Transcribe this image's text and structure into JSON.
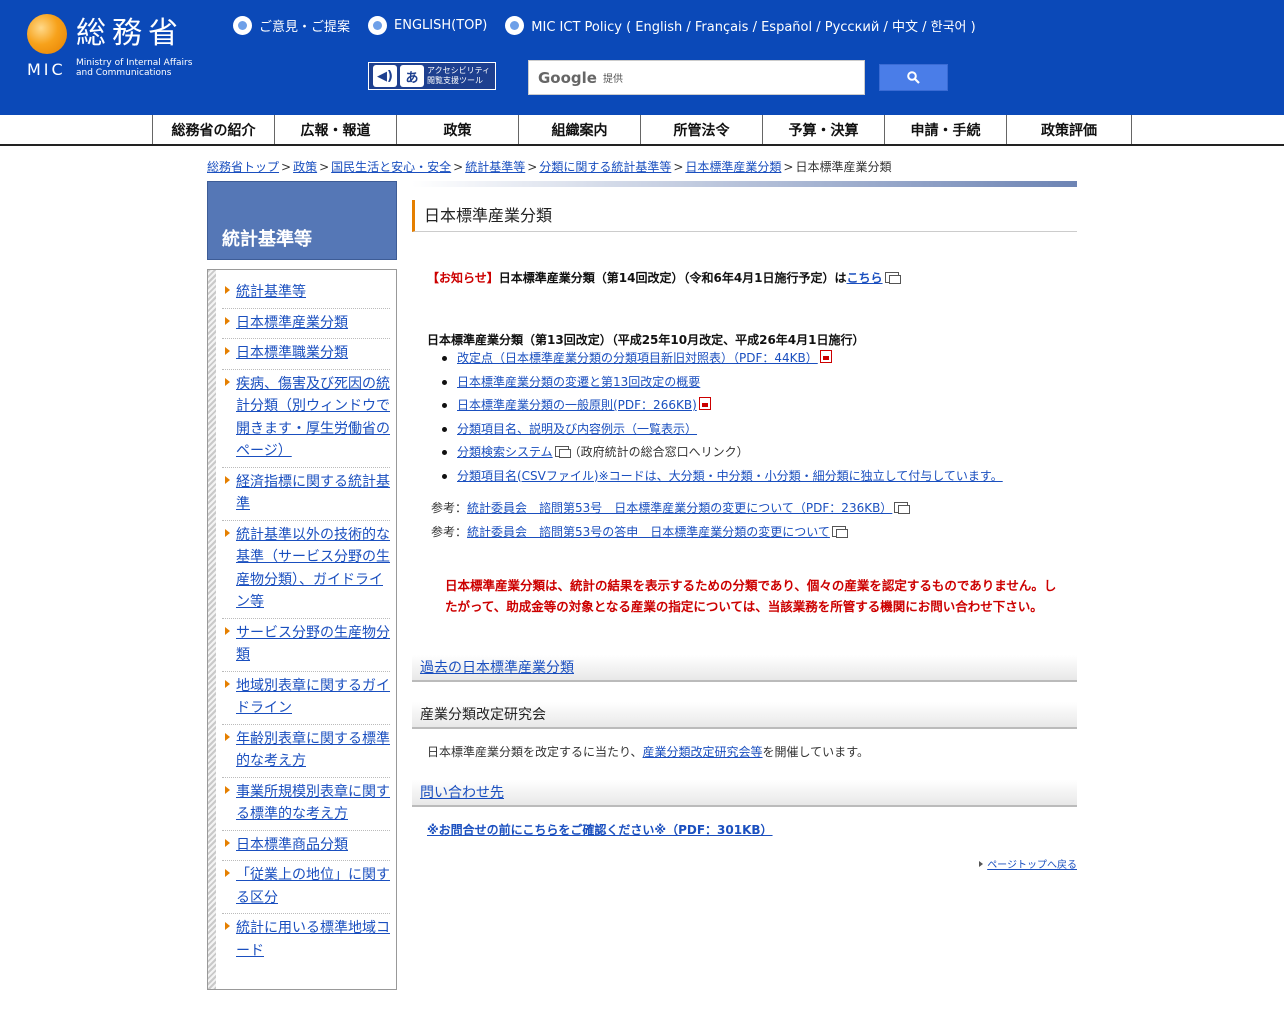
{
  "header": {
    "logo_title": "総務省",
    "logo_mic": "MIC",
    "logo_en1": "Ministry of Internal Affairs",
    "logo_en2": "and Communications",
    "toplinks": [
      "ご意見・ご提案",
      "ENGLISH(TOP)",
      "MIC ICT Policy ( English / Français / Español / Русский / 中文 / 한국어 )"
    ],
    "access_tool_1": "アクセシビリティ",
    "access_tool_2": "閲覧支援ツール",
    "search_logo": "Google",
    "search_sub": "提供"
  },
  "nav": [
    "総務省の紹介",
    "広報・報道",
    "政策",
    "組織案内",
    "所管法令",
    "予算・決算",
    "申請・手続",
    "政策評価"
  ],
  "breadcrumb": [
    "総務省トップ",
    "政策",
    "国民生活と安心・安全",
    "統計基準等",
    "分類に関する統計基準等",
    "日本標準産業分類",
    "日本標準産業分類"
  ],
  "breadcrumb_sep": ">",
  "sidebar": {
    "title": "統計基準等",
    "items": [
      "統計基準等",
      "日本標準産業分類",
      "日本標準職業分類",
      "疾病、傷害及び死因の統計分類（別ウィンドウで開きます・厚生労働省のページ）",
      "経済指標に関する統計基準",
      "統計基準以外の技術的な基準（サービス分野の生産物分類）、ガイドライン等",
      "サービス分野の生産物分類",
      "地域別表章に関するガイドライン",
      "年齢別表章に関する標準的な考え方",
      "事業所規模別表章に関する標準的な考え方",
      "日本標準商品分類",
      "「従業上の地位」に関する区分",
      "統計に用いる標準地域コード"
    ]
  },
  "main": {
    "title": "日本標準産業分類",
    "notice_label": "【お知らせ】",
    "notice_text": "日本標準産業分類（第14回改定）（令和6年4月1日施行予定）は",
    "notice_link": "こちら",
    "section13_title": "日本標準産業分類（第13回改定）（平成25年10月改定、平成26年4月1日施行）",
    "list13": [
      "改定点（日本標準産業分類の分類項目新旧対照表）（PDF：44KB）",
      "日本標準産業分類の変遷と第13回改定の概要",
      "日本標準産業分類の一般原則(PDF：266KB)",
      "分類項目名、説明及び内容例示（一覧表示）",
      "分類検索システム",
      "分類項目名(CSVファイル)※コードは、大分類・中分類・小分類・細分類に独立して付与しています。"
    ],
    "list13_extra": "（政府統計の総合窓口へリンク）",
    "ref_label": "参考：",
    "ref1": "統計委員会　諮問第53号　日本標準産業分類の変更について（PDF：236KB）",
    "ref2": "統計委員会　諮問第53号の答申　日本標準産業分類の変更について",
    "warning": "日本標準産業分類は、統計の結果を表示するための分類であり、個々の産業を認定するものでありません。したがって、助成金等の対象となる産業の指定については、当該業務を所管する機関にお問い合わせ下さい。",
    "past_link": "過去の日本標準産業分類",
    "kenkyu_title": "産業分類改定研究会",
    "kenkyu_text1": "日本標準産業分類を改定するに当たり、",
    "kenkyu_link": "産業分類改定研究会等",
    "kenkyu_text2": "を開催しています。",
    "contact_title": "問い合わせ先",
    "contact_link": "※お問合せの前にこちらをご確認ください※（PDF：301KB）",
    "pagetop": "ページトップへ戻る"
  }
}
